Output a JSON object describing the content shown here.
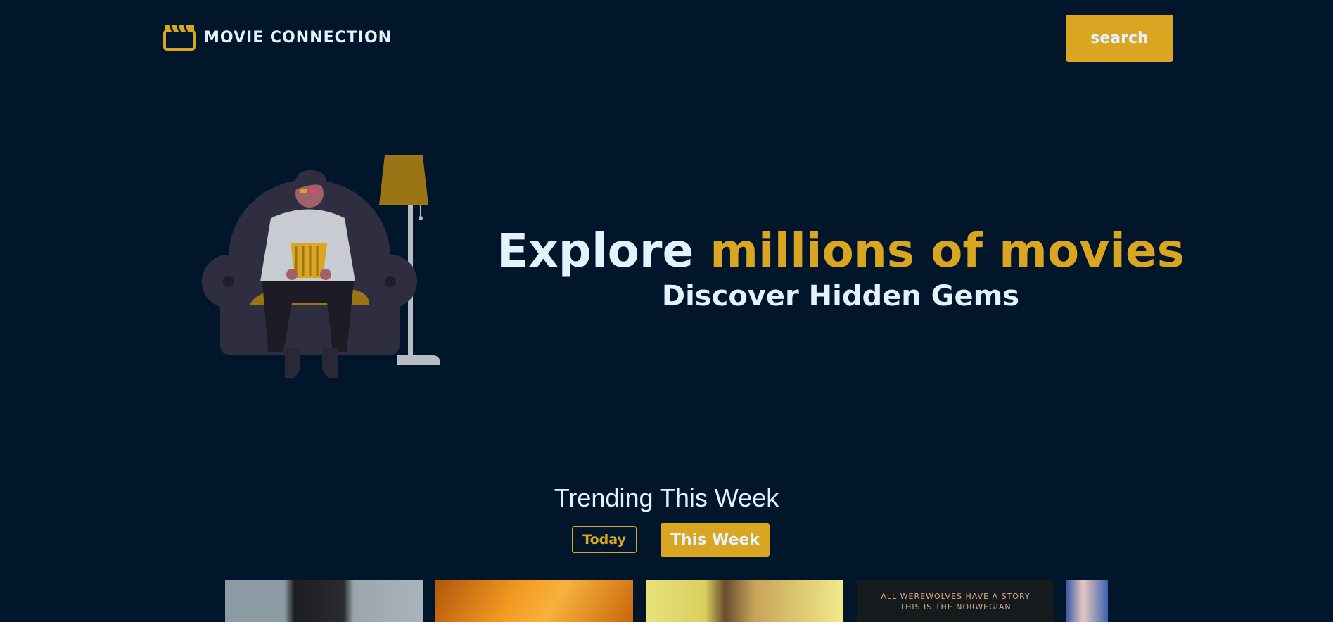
{
  "header": {
    "logo_icon": "clapperboard-icon",
    "logo_text": "MOVIE CONNECTION",
    "search_label": "search"
  },
  "hero": {
    "headline_plain": "Explore ",
    "headline_accent": "millions of movies",
    "subheadline": "Discover Hidden Gems",
    "illustration": "person-on-armchair-with-popcorn"
  },
  "trending": {
    "title": "Trending This Week",
    "tabs": [
      {
        "label": "Today",
        "active": false
      },
      {
        "label": "This Week",
        "active": true
      }
    ],
    "posters": [
      {
        "text": ""
      },
      {
        "text": ""
      },
      {
        "text": ""
      },
      {
        "text_line1": "ALL WEREWOLVES HAVE A STORY",
        "text_line2": "THIS IS THE NORWEGIAN"
      },
      {
        "text": ""
      }
    ]
  },
  "colors": {
    "background": "#01152b",
    "accent": "#daa520",
    "text": "#e3f2fd"
  }
}
